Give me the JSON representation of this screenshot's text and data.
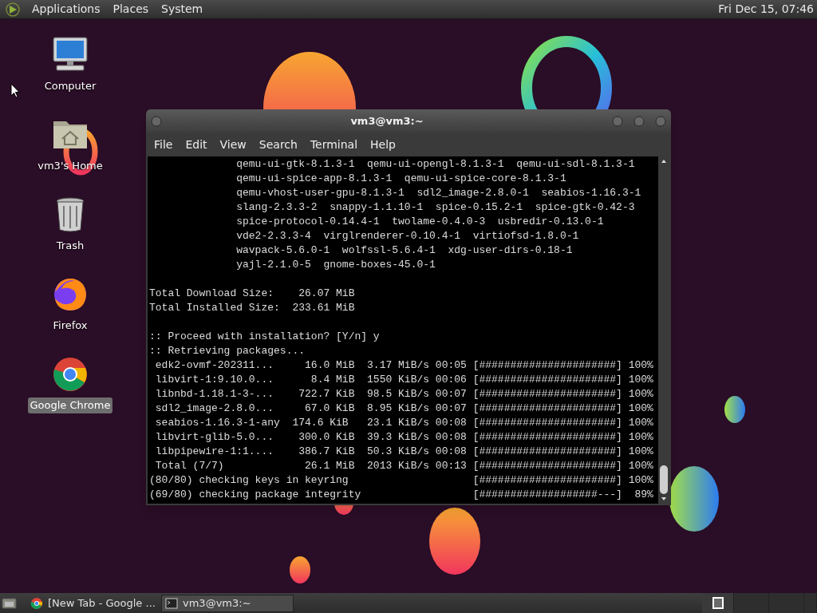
{
  "top_panel": {
    "menus": [
      "Applications",
      "Places",
      "System"
    ],
    "clock": "Fri Dec 15, 07:46"
  },
  "desktop_icons": [
    {
      "kind": "computer",
      "label": "Computer",
      "selected": false
    },
    {
      "kind": "home",
      "label": "vm3's Home",
      "selected": false
    },
    {
      "kind": "trash",
      "label": "Trash",
      "selected": false
    },
    {
      "kind": "firefox",
      "label": "Firefox",
      "selected": false
    },
    {
      "kind": "chrome",
      "label": "Google Chrome",
      "selected": true
    }
  ],
  "terminal": {
    "title": "vm3@vm3:~",
    "menu": [
      "File",
      "Edit",
      "View",
      "Search",
      "Terminal",
      "Help"
    ],
    "blocks": [
      [
        "              qemu-ui-gtk-8.1.3-1  qemu-ui-opengl-8.1.3-1  qemu-ui-sdl-8.1.3-1",
        "              qemu-ui-spice-app-8.1.3-1  qemu-ui-spice-core-8.1.3-1",
        "              qemu-vhost-user-gpu-8.1.3-1  sdl2_image-2.8.0-1  seabios-1.16.3-1",
        "              slang-2.3.3-2  snappy-1.1.10-1  spice-0.15.2-1  spice-gtk-0.42-3",
        "              spice-protocol-0.14.4-1  twolame-0.4.0-3  usbredir-0.13.0-1",
        "              vde2-2.3.3-4  virglrenderer-0.10.4-1  virtiofsd-1.8.0-1",
        "              wavpack-5.6.0-1  wolfssl-5.6.4-1  xdg-user-dirs-0.18-1",
        "              yajl-2.1.0-5  gnome-boxes-45.0-1"
      ],
      [
        "Total Download Size:    26.07 MiB",
        "Total Installed Size:  233.61 MiB"
      ],
      [
        ":: Proceed with installation? [Y/n] y",
        ":: Retrieving packages...",
        " edk2-ovmf-202311...     16.0 MiB  3.17 MiB/s 00:05 [######################] 100%",
        " libvirt-1:9.10.0...      8.4 MiB  1550 KiB/s 00:06 [######################] 100%",
        " libnbd-1.18.1-3-...    722.7 KiB  98.5 KiB/s 00:07 [######################] 100%",
        " sdl2_image-2.8.0...     67.0 KiB  8.95 KiB/s 00:07 [######################] 100%",
        " seabios-1.16.3-1-any  174.6 KiB   23.1 KiB/s 00:08 [######################] 100%",
        " libvirt-glib-5.0...    300.0 KiB  39.3 KiB/s 00:08 [######################] 100%",
        " libpipewire-1:1....    386.7 KiB  50.3 KiB/s 00:08 [######################] 100%",
        " Total (7/7)             26.1 MiB  2013 KiB/s 00:13 [######################] 100%",
        "(80/80) checking keys in keyring                    [######################] 100%",
        "(69/80) checking package integrity                  [###################---]  89%"
      ]
    ]
  },
  "taskbar": {
    "tasks": [
      {
        "kind": "chrome",
        "label": "[New Tab - Google ...",
        "selected": false
      },
      {
        "kind": "terminal",
        "label": "vm3@vm3:~",
        "selected": true
      }
    ]
  }
}
